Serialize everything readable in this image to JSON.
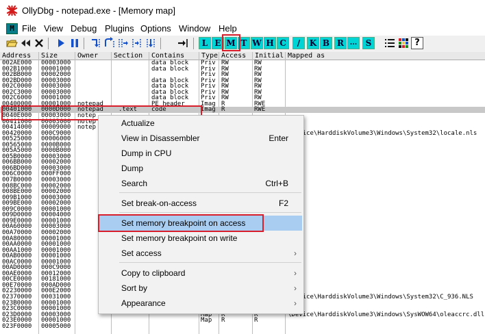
{
  "window": {
    "title": "OllyDbg - notepad.exe - [Memory map]"
  },
  "menubar": {
    "logo": "M",
    "items": [
      "File",
      "View",
      "Debug",
      "Plugins",
      "Options",
      "Window",
      "Help"
    ]
  },
  "toolbar": {
    "letter_buttons": [
      "L",
      "E",
      "M",
      "T",
      "W",
      "H",
      "C",
      "/",
      "K",
      "B",
      "R",
      "...",
      "S"
    ],
    "active_button": "M"
  },
  "table": {
    "columns": [
      "Address",
      "Size",
      "Owner",
      "Section",
      "Contains",
      "Type",
      "Access",
      "Initial",
      "Mapped as"
    ],
    "rows": [
      [
        "002AE000",
        "00003000",
        "",
        "",
        "data block",
        "Priv",
        "RW",
        "RW",
        ""
      ],
      [
        "002B1000",
        "00001000",
        "",
        "",
        "data block",
        "Priv",
        "RW",
        "RW",
        ""
      ],
      [
        "002BB000",
        "00002000",
        "",
        "",
        "",
        "Priv",
        "RW",
        "RW",
        ""
      ],
      [
        "002BD000",
        "00003000",
        "",
        "",
        "data block",
        "Priv",
        "RW",
        "RW",
        ""
      ],
      [
        "002C0000",
        "00003000",
        "",
        "",
        "data block",
        "Priv",
        "RW",
        "RW",
        ""
      ],
      [
        "002C3000",
        "00003000",
        "",
        "",
        "data block",
        "Priv",
        "RW",
        "RW",
        ""
      ],
      [
        "002C6000",
        "00001000",
        "",
        "",
        "data block",
        "Priv",
        "RW",
        "RW",
        ""
      ],
      [
        "00400000",
        "00001000",
        "notepad",
        "",
        "PE header",
        "Imag",
        "R",
        "RWE",
        ""
      ],
      [
        "00401000",
        "0000D000",
        "notepad",
        ".text",
        "code",
        "Imag",
        "R",
        "RWE",
        ""
      ],
      [
        "0040E000",
        "00003000",
        "notep",
        "",
        "",
        "",
        "",
        "",
        ""
      ],
      [
        "00411000",
        "00003000",
        "notep",
        "",
        "",
        "",
        "",
        "",
        ""
      ],
      [
        "00414000",
        "00009000",
        "notep",
        "",
        "",
        "",
        "",
        "",
        ""
      ],
      [
        "00420000",
        "000C9000",
        "",
        "",
        "",
        "",
        "",
        "",
        "\\Device\\HarddiskVolume3\\Windows\\System32\\locale.nls"
      ],
      [
        "00525000",
        "00006000",
        "",
        "",
        "",
        "",
        "",
        "",
        ""
      ],
      [
        "00565000",
        "0000B000",
        "",
        "",
        "",
        "",
        "",
        "",
        ""
      ],
      [
        "005A5000",
        "0000B000",
        "",
        "",
        "",
        "",
        "",
        "",
        ""
      ],
      [
        "005B0000",
        "00003000",
        "",
        "",
        "",
        "",
        "",
        "",
        ""
      ],
      [
        "006BB000",
        "00002000",
        "",
        "",
        "",
        "",
        "",
        "",
        ""
      ],
      [
        "006BD000",
        "00003000",
        "",
        "",
        "",
        "",
        "",
        "",
        ""
      ],
      [
        "006C0000",
        "000FF000",
        "",
        "",
        "",
        "",
        "",
        "",
        ""
      ],
      [
        "007B0000",
        "00003000",
        "",
        "",
        "",
        "",
        "",
        "",
        ""
      ],
      [
        "008BC000",
        "00002000",
        "",
        "",
        "",
        "",
        "",
        "",
        ""
      ],
      [
        "008BE000",
        "00002000",
        "",
        "",
        "",
        "",
        "",
        "",
        ""
      ],
      [
        "009B1000",
        "00003000",
        "",
        "",
        "",
        "",
        "",
        "",
        ""
      ],
      [
        "009BE000",
        "00002000",
        "",
        "",
        "",
        "",
        "",
        "",
        ""
      ],
      [
        "009C0000",
        "00001000",
        "",
        "",
        "",
        "",
        "",
        "",
        ""
      ],
      [
        "009D0000",
        "00004000",
        "",
        "",
        "",
        "",
        "",
        "",
        ""
      ],
      [
        "009E0000",
        "00001000",
        "",
        "",
        "",
        "",
        "",
        "",
        ""
      ],
      [
        "00A60000",
        "00003000",
        "",
        "",
        "",
        "",
        "",
        "",
        ""
      ],
      [
        "00A70000",
        "00002000",
        "",
        "",
        "",
        "",
        "",
        "",
        ""
      ],
      [
        "00A80000",
        "00001000",
        "",
        "",
        "",
        "",
        "",
        "",
        ""
      ],
      [
        "00AA0000",
        "00001000",
        "",
        "",
        "",
        "",
        "",
        "",
        ""
      ],
      [
        "00AA1000",
        "00001000",
        "",
        "",
        "",
        "",
        "",
        "",
        ""
      ],
      [
        "00AB0000",
        "00001000",
        "",
        "",
        "",
        "",
        "",
        "",
        ""
      ],
      [
        "00AC0000",
        "00001000",
        "",
        "",
        "",
        "",
        "",
        "",
        ""
      ],
      [
        "00AD0000",
        "000C9000",
        "",
        "",
        "",
        "",
        "",
        "",
        ""
      ],
      [
        "00AE0000",
        "00012000",
        "",
        "",
        "",
        "",
        "",
        "",
        ""
      ],
      [
        "00CE0000",
        "00181000",
        "",
        "",
        "",
        "",
        "",
        "",
        ""
      ],
      [
        "00E70000",
        "000AD000",
        "",
        "",
        "",
        "",
        "",
        "",
        ""
      ],
      [
        "02230000",
        "000E2000",
        "",
        "",
        "",
        "",
        "",
        "",
        ""
      ],
      [
        "02370000",
        "00031000",
        "",
        "",
        "",
        "",
        "",
        "",
        "\\Device\\HarddiskVolume3\\Windows\\System32\\C_936.NLS"
      ],
      [
        "023B0000",
        "00001000",
        "",
        "",
        "",
        "",
        "",
        "",
        ""
      ],
      [
        "023C0000",
        "00001000",
        "",
        "",
        "",
        "Map",
        "R",
        "R",
        ""
      ],
      [
        "023D0000",
        "00003000",
        "",
        "",
        "",
        "Map",
        "R",
        "R",
        "\\Device\\HarddiskVolume3\\Windows\\SysWOW64\\oleaccrc.dll"
      ],
      [
        "023E0000",
        "00001000",
        "",
        "",
        "",
        "Map",
        "R",
        "R",
        ""
      ],
      [
        "023F0000",
        "00005000",
        "",
        "",
        "",
        "",
        "",
        "",
        ""
      ]
    ]
  },
  "context_menu": {
    "items": [
      {
        "label": "Actualize",
        "shortcut": ""
      },
      {
        "label": "View in Disassembler",
        "shortcut": "Enter"
      },
      {
        "label": "Dump in CPU",
        "shortcut": ""
      },
      {
        "label": "Dump",
        "shortcut": ""
      },
      {
        "label": "Search",
        "shortcut": "Ctrl+B"
      },
      {
        "label": "Set break-on-access",
        "shortcut": "F2"
      },
      {
        "label": "Set memory breakpoint on access",
        "shortcut": ""
      },
      {
        "label": "Set memory breakpoint on write",
        "shortcut": ""
      },
      {
        "label": "Set access",
        "shortcut": ""
      },
      {
        "label": "Copy to clipboard",
        "shortcut": ""
      },
      {
        "label": "Sort by",
        "shortcut": ""
      },
      {
        "label": "Appearance",
        "shortcut": ""
      }
    ],
    "highlighted": "Set memory breakpoint on access"
  },
  "colors": {
    "toolbar_letter_bg": "#00d4d4",
    "highlight_box": "#d81e2a",
    "menu_highlight": "#a9cdf1"
  }
}
